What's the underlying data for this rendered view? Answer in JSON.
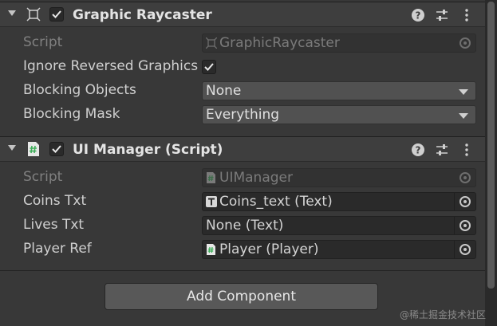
{
  "graphic_raycaster": {
    "title": "Graphic Raycaster",
    "enabled": true,
    "icon": "rect-transform-icon",
    "rows": {
      "script_label": "Script",
      "script_value": "GraphicRaycaster",
      "ignore_reversed_label": "Ignore Reversed Graphics",
      "ignore_reversed_checked": true,
      "blocking_objects_label": "Blocking Objects",
      "blocking_objects_value": "None",
      "blocking_mask_label": "Blocking Mask",
      "blocking_mask_value": "Everything"
    }
  },
  "ui_manager": {
    "title": "UI Manager (Script)",
    "enabled": true,
    "icon": "csharp-script-icon",
    "rows": {
      "script_label": "Script",
      "script_value": "UIManager",
      "coins_label": "Coins Txt",
      "coins_value": "Coins_text (Text)",
      "lives_label": "Lives Txt",
      "lives_value": "None (Text)",
      "player_label": "Player Ref",
      "player_value": "Player (Player)"
    }
  },
  "add_component_label": "Add Component",
  "watermark": "@稀土掘金技术社区",
  "colors": {
    "background": "#383838",
    "header": "#3e3e3e",
    "field": "#2a2a2a",
    "script_icon_green": "#3fae5a"
  }
}
